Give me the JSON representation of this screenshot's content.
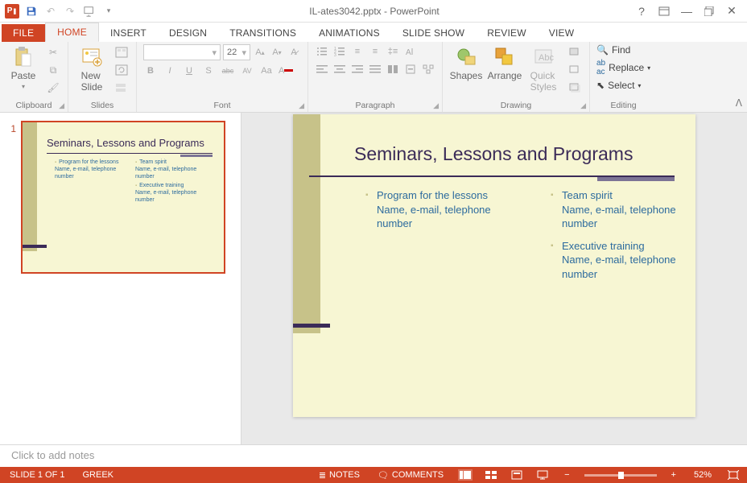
{
  "app": {
    "title": "IL-ates3042.pptx - PowerPoint",
    "icon_label": "P"
  },
  "qat": [
    "save",
    "undo",
    "redo",
    "start-from-beginning",
    "customize"
  ],
  "winbuttons": {
    "help": "?",
    "ribbon_opts": "▢",
    "min": "—",
    "restore": "❐",
    "close": "✕"
  },
  "tabs": {
    "file": "FILE",
    "items": [
      "HOME",
      "INSERT",
      "DESIGN",
      "TRANSITIONS",
      "ANIMATIONS",
      "SLIDE SHOW",
      "REVIEW",
      "VIEW"
    ],
    "active": 0
  },
  "ribbon": {
    "clipboard": {
      "label": "Clipboard",
      "paste": "Paste"
    },
    "slides": {
      "label": "Slides",
      "newslide": "New\nSlide"
    },
    "font": {
      "label": "Font",
      "size": "22",
      "row2": [
        "B",
        "I",
        "U",
        "S",
        "abc",
        "AV",
        "Aa",
        "A"
      ]
    },
    "paragraph": {
      "label": "Paragraph"
    },
    "drawing": {
      "label": "Drawing",
      "shapes": "Shapes",
      "arrange": "Arrange",
      "quick": "Quick\nStyles"
    },
    "editing": {
      "label": "Editing",
      "find": "Find",
      "replace": "Replace",
      "select": "Select"
    }
  },
  "thumbnail": {
    "number": "1"
  },
  "slide": {
    "title": "Seminars, Lessons and Programs",
    "left": [
      {
        "heading": "Program for the lessons",
        "sub": "Name, e-mail, telephone number"
      }
    ],
    "right": [
      {
        "heading": "Team spirit",
        "sub": "Name, e-mail, telephone number"
      },
      {
        "heading": "Executive training",
        "sub": "Name, e-mail, telephone number"
      }
    ]
  },
  "notes": {
    "placeholder": "Click to add notes"
  },
  "status": {
    "slideinfo": "SLIDE 1 OF 1",
    "lang": "GREEK",
    "notes_btn": "NOTES",
    "comments_btn": "COMMENTS",
    "zoom": "52%"
  }
}
